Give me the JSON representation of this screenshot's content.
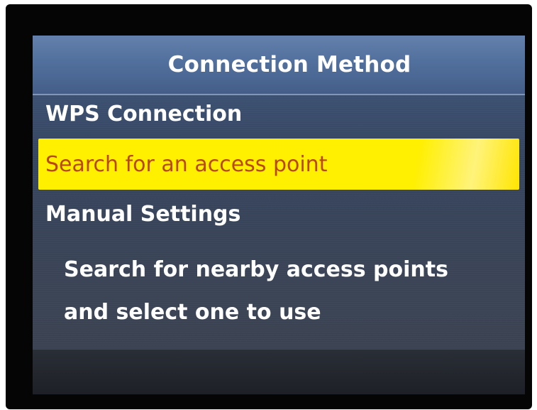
{
  "header": {
    "title": "Connection Method"
  },
  "menu": {
    "items": [
      {
        "label": "WPS Connection",
        "selected": false
      },
      {
        "label": "Search for an access point",
        "selected": true
      },
      {
        "label": "Manual Settings",
        "selected": false
      }
    ]
  },
  "description": {
    "line1": "Search for nearby access points",
    "line2": "and select one to use"
  },
  "colors": {
    "highlight": "#fff000",
    "highlight_text": "#b8480f",
    "title_bar": "#52709d",
    "background": "#36455f"
  }
}
